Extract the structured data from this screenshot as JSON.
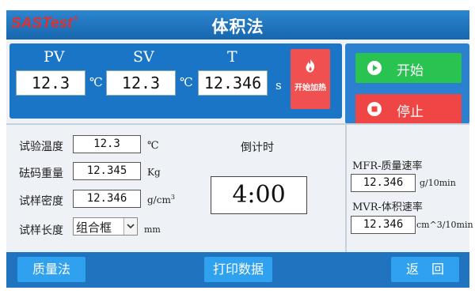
{
  "header": {
    "brand": "SASTest",
    "brand_mark": "®",
    "title": "体积法"
  },
  "readings": {
    "pv": {
      "label": "PV",
      "value": "12.3",
      "unit": "℃"
    },
    "sv": {
      "label": "SV",
      "value": "12.3",
      "unit": "℃"
    },
    "t": {
      "label": "T",
      "value": "12.346",
      "unit": "s"
    },
    "heat_button": "开始加热"
  },
  "controls": {
    "start": "开始",
    "stop": "停止"
  },
  "params": {
    "test_temp": {
      "label": "试验温度",
      "value": "12.3",
      "unit": "℃"
    },
    "weight": {
      "label": "砝码重量",
      "value": "12.345",
      "unit": "Kg"
    },
    "density": {
      "label": "试样密度",
      "value": "12.346",
      "unit": "g/cm",
      "unit_sup": "3"
    },
    "length": {
      "label": "试样长度",
      "select_value": "组合框",
      "unit": "mm"
    }
  },
  "countdown": {
    "label": "倒计时",
    "value": "4:00"
  },
  "rates": {
    "mfr": {
      "label": "MFR-质量速率",
      "value": "12.346",
      "unit": "g/10min"
    },
    "mvr": {
      "label": "MVR-体积速率",
      "value": "12.346",
      "unit": "cm^3/10min"
    }
  },
  "nav": {
    "mass_method": "质量法",
    "print": "打印数据",
    "back": "返　回"
  },
  "colors": {
    "title_bar": "#1766ad",
    "start_green": "#28c350",
    "stop_red": "#f04545",
    "heat_red": "#f05050"
  }
}
